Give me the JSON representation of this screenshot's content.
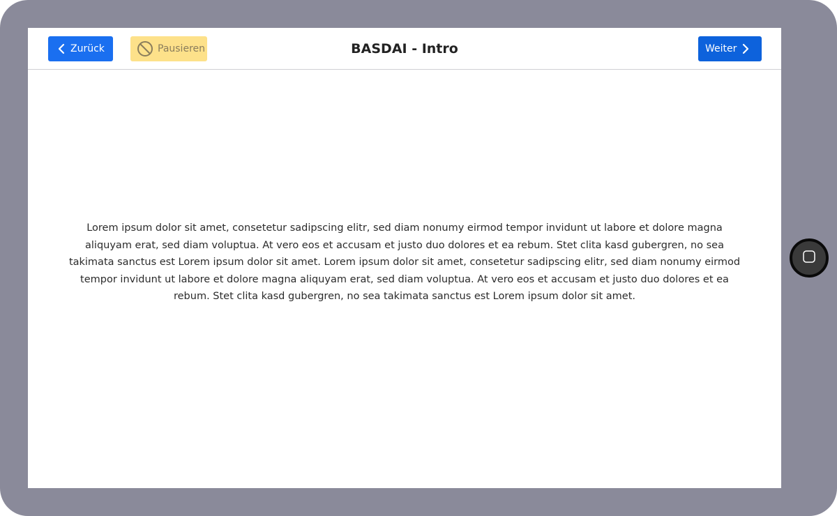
{
  "header": {
    "title": "BASDAI - Intro",
    "back_label": "Zurück",
    "pause_label": "Pausieren",
    "next_label": "Weiter"
  },
  "content": {
    "text": "Lorem ipsum dolor sit amet, consetetur sadipscing elitr, sed diam nonumy eirmod tempor invidunt ut labore et dolore magna aliquyam erat, sed diam voluptua. At vero eos et accusam et justo duo dolores et ea rebum. Stet clita kasd gubergren, no sea takimata sanctus est Lorem ipsum dolor sit amet. Lorem ipsum dolor sit amet, consetetur sadipscing elitr, sed diam nonumy eirmod tempor invidunt ut labore et dolore magna aliquyam erat, sed diam voluptua. At vero eos et accusam et justo duo dolores et ea rebum. Stet clita kasd gubergren, no sea takimata sanctus est Lorem ipsum dolor sit amet."
  },
  "icons": {
    "back": "chevron-left-icon",
    "pause": "prohibited-icon",
    "next": "chevron-right-icon",
    "home": "home-square-icon"
  },
  "colors": {
    "frame": "#8a8a9a",
    "primary": "#1a6ff0",
    "primary_dark": "#0d62dc",
    "warning": "#fde18a",
    "warning_text": "#8a7d5c"
  }
}
